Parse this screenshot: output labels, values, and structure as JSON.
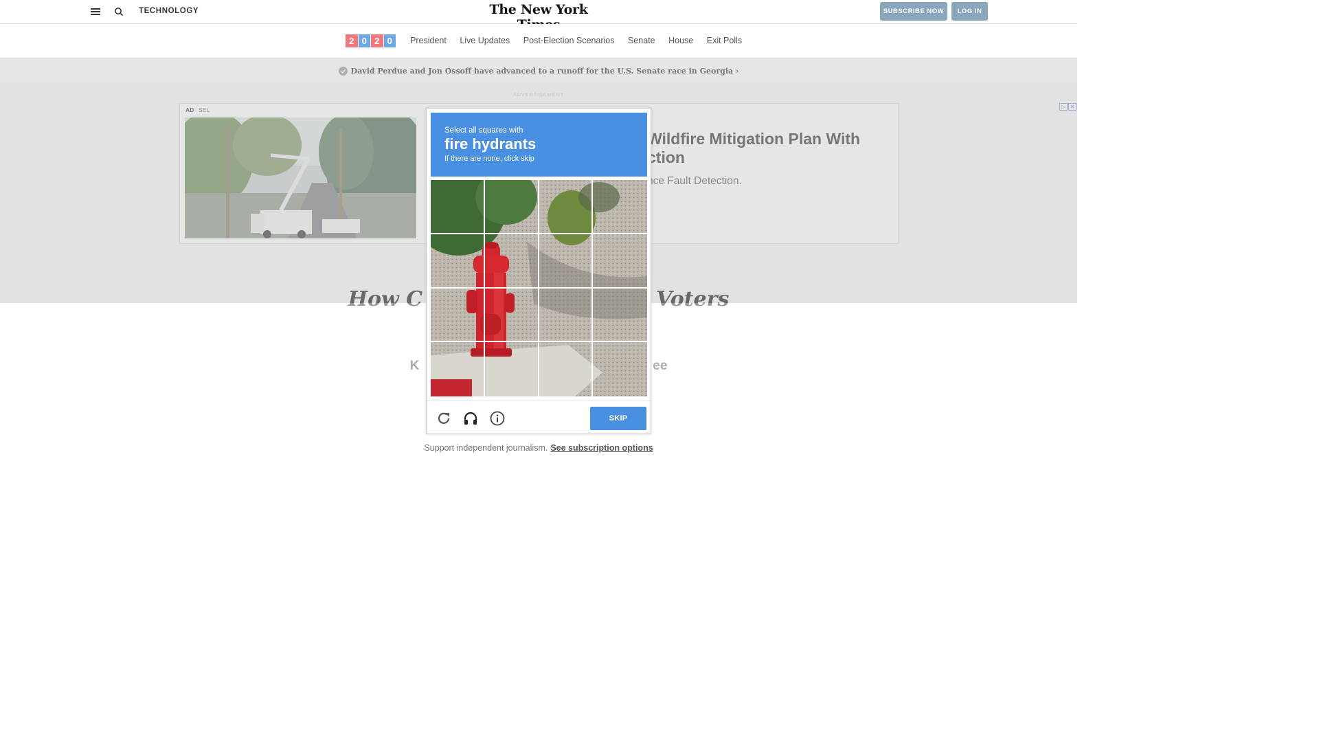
{
  "topbar": {
    "section": "TECHNOLOGY",
    "logo": "The New York Times",
    "subscribe_label": "SUBSCRIBE NOW",
    "login_label": "LOG IN"
  },
  "election_nav": {
    "digits": [
      "2",
      "0",
      "2",
      "0"
    ],
    "links": [
      "President",
      "Live Updates",
      "Post-Election Scenarios",
      "Senate",
      "House",
      "Exit Polls"
    ]
  },
  "alert": {
    "text": "David Perdue and Jon Ossoff have advanced to a runoff for the U.S. Senate race in Georgia ›"
  },
  "ad": {
    "label": "ADVERTISEMENT",
    "tag": "AD",
    "sponsor": "SEL",
    "headline": "Wildfire Mitigation Plan With ction",
    "subtext": "nce Fault Detection."
  },
  "article": {
    "title_left": "How C",
    "title_right": "Voters",
    "kicker_left": "K",
    "kicker_right": "ee"
  },
  "captcha": {
    "line1": "Select all squares with",
    "line2": "fire hydrants",
    "line3": "If there are none, click skip",
    "skip_label": "SKIP"
  },
  "support": {
    "text": "Support independent journalism.",
    "link": "See subscription options"
  },
  "colors": {
    "captcha_blue": "#4a90e2",
    "button_blue_gray": "#8aa6bd",
    "digit_red": "#f2777f",
    "digit_blue": "#6aa9e6"
  }
}
